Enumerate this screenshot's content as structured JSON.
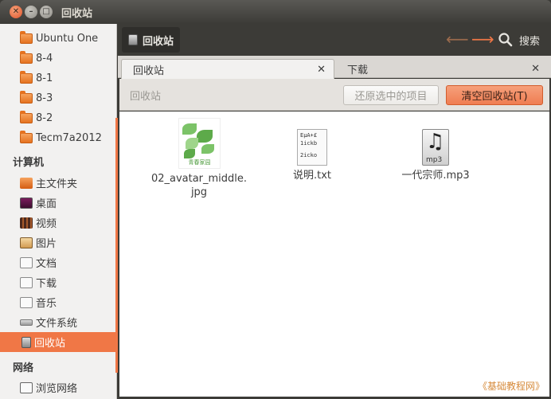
{
  "window": {
    "title": "回收站"
  },
  "sidebar": {
    "bookmarks": [
      {
        "label": "Ubuntu One",
        "icon": "folder-icon"
      },
      {
        "label": "8-4",
        "icon": "folder-icon"
      },
      {
        "label": "8-1",
        "icon": "folder-icon"
      },
      {
        "label": "8-3",
        "icon": "folder-icon"
      },
      {
        "label": "8-2",
        "icon": "folder-icon"
      },
      {
        "label": "Tecm7a2012",
        "icon": "folder-icon"
      }
    ],
    "computer_heading": "计算机",
    "computer": [
      {
        "label": "主文件夹",
        "icon": "home-folder-icon"
      },
      {
        "label": "桌面",
        "icon": "desktop-icon"
      },
      {
        "label": "视频",
        "icon": "videos-icon"
      },
      {
        "label": "图片",
        "icon": "pictures-icon"
      },
      {
        "label": "文档",
        "icon": "documents-icon"
      },
      {
        "label": "下载",
        "icon": "downloads-icon"
      },
      {
        "label": "音乐",
        "icon": "music-icon"
      },
      {
        "label": "文件系统",
        "icon": "filesystem-icon"
      },
      {
        "label": "回收站",
        "icon": "trash-icon",
        "active": true
      }
    ],
    "network_heading": "网络",
    "network": [
      {
        "label": "浏览网络",
        "icon": "network-icon"
      }
    ]
  },
  "toolbar": {
    "location": "回收站",
    "search_label": "搜索"
  },
  "tabs": [
    {
      "label": "回收站",
      "active": true
    },
    {
      "label": "下载",
      "active": false
    }
  ],
  "trash_bar": {
    "title": "回收站",
    "restore_label": "还原选中的项目",
    "empty_label": "清空回收站(T)"
  },
  "files": [
    {
      "name": "02_avatar_middle.jpg",
      "name_lines": [
        "02_avatar_middle.",
        "jpg"
      ],
      "type": "image",
      "thumb_text": "青春家园"
    },
    {
      "name": "说明.txt",
      "name_lines": [
        "说明.txt"
      ],
      "type": "text",
      "thumb_lines": [
        "EµA+£",
        "1ickb",
        "",
        "2icko"
      ]
    },
    {
      "name": "一代宗师.mp3",
      "name_lines": [
        "一代宗师.mp3"
      ],
      "type": "audio",
      "thumb_ext": "mp3"
    }
  ],
  "watermark": "《基础教程网》",
  "colors": {
    "accent": "#f07746",
    "titlebar": "#3c3b37",
    "sidebar_bg": "#f2f1f0"
  }
}
